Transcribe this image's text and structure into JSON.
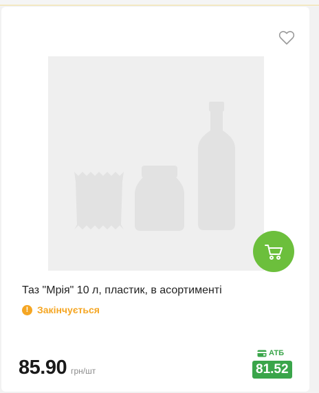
{
  "product": {
    "title": "Таз \"Мрія\" 10 л, пластик, в асортименті",
    "status": "Закінчується",
    "status_icon": "!",
    "price": "85.90",
    "price_unit": "грн/шт",
    "atb_label": "АТБ",
    "atb_price": "81.52"
  },
  "icons": {
    "favorite": "heart-outline-icon",
    "cart": "cart-icon",
    "status": "warning-icon",
    "atb_card": "card-icon",
    "placeholder": "product-placeholder-image"
  },
  "colors": {
    "cart_button": "#6cbf3c",
    "status": "#f5a623",
    "atb_green": "#3aa54a",
    "placeholder_bg": "#efefef",
    "placeholder_shapes": "#e2e2e2"
  }
}
